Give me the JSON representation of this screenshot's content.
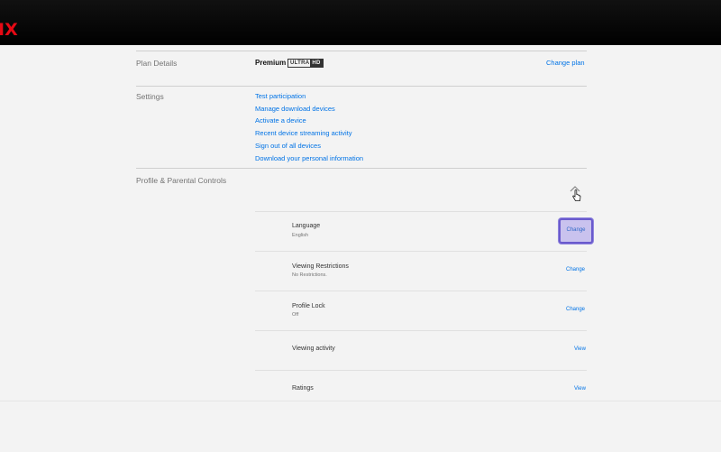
{
  "header": {
    "logo_text": "IX",
    "brand_color": "#e50914"
  },
  "plan": {
    "section_label": "Plan Details",
    "plan_name": "Premium",
    "badge_left": "ULTRA",
    "badge_right": "HD",
    "change_plan_label": "Change plan"
  },
  "settings": {
    "section_label": "Settings",
    "links": [
      "Test participation",
      "Manage download devices",
      "Activate a device",
      "Recent device streaming activity",
      "Sign out of all devices",
      "Download your personal information"
    ]
  },
  "profile": {
    "section_label": "Profile & Parental Controls",
    "collapse_icon": "chevron-up-icon",
    "rows": [
      {
        "title": "Language",
        "subtitle": "English",
        "action": "Change"
      },
      {
        "title": "Viewing Restrictions",
        "subtitle": "No Restrictions.",
        "action": "Change"
      },
      {
        "title": "Profile Lock",
        "subtitle": "Off",
        "action": "Change"
      },
      {
        "title": "Viewing activity",
        "subtitle": "",
        "action": "View"
      },
      {
        "title": "Ratings",
        "subtitle": "",
        "action": "View"
      }
    ]
  },
  "colors": {
    "link": "#0073e6",
    "focus_ring": "#6a5acd",
    "focus_fill": "#c9c2ee"
  }
}
